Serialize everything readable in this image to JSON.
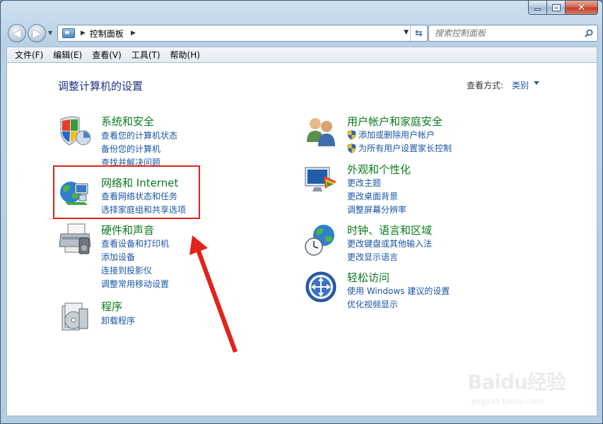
{
  "window": {
    "minimize_icon": "minimize-icon",
    "maximize_icon": "maximize-icon",
    "close_icon": "close-icon"
  },
  "address": {
    "path": "控制面板",
    "search_placeholder": "搜索控制面板"
  },
  "menu": [
    "文件(F)",
    "编辑(E)",
    "查看(V)",
    "工具(T)",
    "帮助(H)"
  ],
  "page": {
    "title": "调整计算机的设置",
    "view_label": "查看方式:",
    "view_value": "类别"
  },
  "categories": {
    "system": {
      "title": "系统和安全",
      "links": [
        "查看您的计算机状态",
        "备份您的计算机",
        "查找并解决问题"
      ]
    },
    "network": {
      "title": "网络和 Internet",
      "links": [
        "查看网络状态和任务",
        "选择家庭组和共享选项"
      ]
    },
    "hardware": {
      "title": "硬件和声音",
      "links": [
        "查看设备和打印机",
        "添加设备",
        "连接到投影仪",
        "调整常用移动设置"
      ]
    },
    "programs": {
      "title": "程序",
      "links": [
        "卸载程序"
      ]
    },
    "users": {
      "title": "用户帐户和家庭安全",
      "links": [
        "添加或删除用户帐户",
        "为所有用户设置家长控制"
      ]
    },
    "appearance": {
      "title": "外观和个性化",
      "links": [
        "更改主题",
        "更改桌面背景",
        "调整屏幕分辨率"
      ]
    },
    "clock": {
      "title": "时钟、语言和区域",
      "links": [
        "更改键盘或其他输入法",
        "更改显示语言"
      ]
    },
    "ease": {
      "title": "轻松访问",
      "links": [
        "使用 Windows 建议的设置",
        "优化视频显示"
      ]
    }
  },
  "watermark": {
    "brand": "Baidu经验",
    "url": "jingyan.baidu.com"
  },
  "colors": {
    "category_title": "#0a7a1e",
    "link": "#1b55a6",
    "highlight": "#e2231a"
  }
}
